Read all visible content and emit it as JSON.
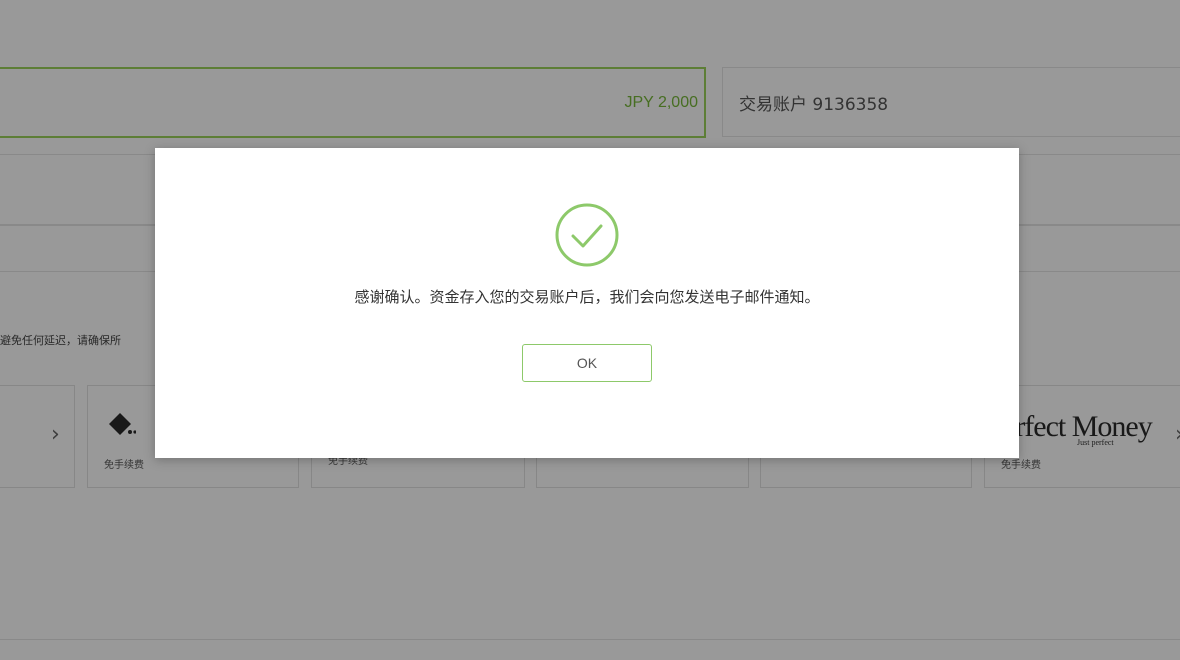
{
  "background": {
    "amount": "JPY 2,000",
    "account": "交易账户 9136358",
    "note": "避免任何延迟，请确保所",
    "payment_cards": [
      {
        "fee": ""
      },
      {
        "fee": "免手续费"
      },
      {
        "fee": "免手续费"
      },
      {
        "fee": ""
      },
      {
        "fee": ""
      },
      {
        "fee": "免手续费",
        "logo": "erfect Money",
        "logo_sub": "Just perfect"
      }
    ]
  },
  "modal": {
    "icon": "check-circle-icon",
    "message": "感谢确认。资金存入您的交易账户后，我们会向您发送电子邮件通知。",
    "ok_label": "OK"
  },
  "colors": {
    "accent_green": "#77b83a",
    "overlay": "rgba(0,0,0,0.40)"
  }
}
